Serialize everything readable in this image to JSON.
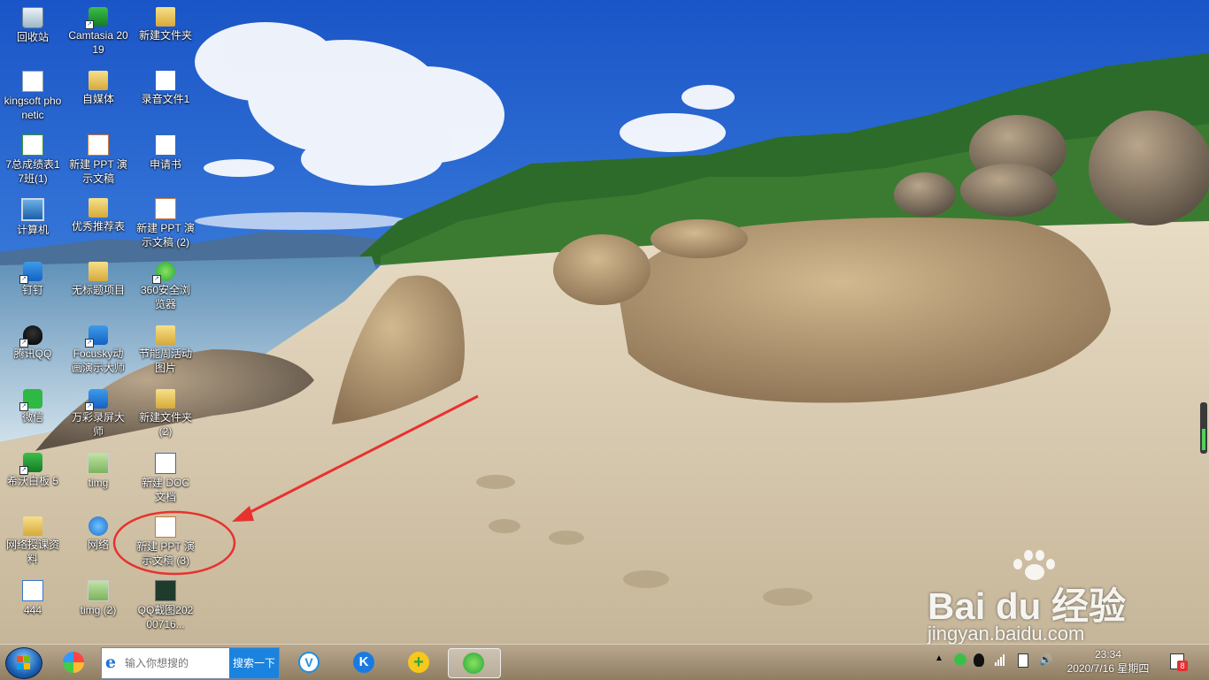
{
  "desktop_icons": [
    {
      "name": "recycle-bin",
      "label": "回收站",
      "glyph": "g-bin",
      "shortcut": false
    },
    {
      "name": "camtasia",
      "label": "Camtasia 2019",
      "glyph": "g-app-green",
      "shortcut": true
    },
    {
      "name": "new-folder",
      "label": "新建文件夹",
      "glyph": "g-folder",
      "shortcut": false
    },
    {
      "name": "kingsoft-phonetic",
      "label": "kingsoft phonetic",
      "glyph": "g-doc",
      "shortcut": false
    },
    {
      "name": "self-media",
      "label": "自媒体",
      "glyph": "g-folder",
      "shortcut": false
    },
    {
      "name": "recording-file-1",
      "label": "录音文件1",
      "glyph": "g-play",
      "shortcut": false
    },
    {
      "name": "grade-sheet",
      "label": "7总成绩表17班(1)",
      "glyph": "g-xls",
      "shortcut": false
    },
    {
      "name": "new-ppt",
      "label": "新建 PPT 演示文稿",
      "glyph": "g-ppt",
      "shortcut": false
    },
    {
      "name": "application-letter",
      "label": "申请书",
      "glyph": "g-word",
      "shortcut": false
    },
    {
      "name": "computer",
      "label": "计算机",
      "glyph": "g-pc",
      "shortcut": false
    },
    {
      "name": "excellent-recommendation",
      "label": "优秀推荐表",
      "glyph": "g-folder",
      "shortcut": false
    },
    {
      "name": "new-ppt-2",
      "label": "新建 PPT 演示文稿 (2)",
      "glyph": "g-ppt",
      "shortcut": false
    },
    {
      "name": "dingding",
      "label": "钉钉",
      "glyph": "g-blue",
      "shortcut": true
    },
    {
      "name": "untitled-project",
      "label": "无标题项目",
      "glyph": "g-folder",
      "shortcut": false
    },
    {
      "name": "360-browser",
      "label": "360安全浏览器",
      "glyph": "g-360",
      "shortcut": true
    },
    {
      "name": "tencent-qq",
      "label": "腾讯QQ",
      "glyph": "g-qq",
      "shortcut": true
    },
    {
      "name": "focusky",
      "label": "Focusky动画演示大师",
      "glyph": "g-blue",
      "shortcut": true
    },
    {
      "name": "energy-week-pictures",
      "label": "节能周活动图片",
      "glyph": "g-folder",
      "shortcut": false
    },
    {
      "name": "wechat",
      "label": "微信",
      "glyph": "g-wx",
      "shortcut": true
    },
    {
      "name": "wancai-recorder",
      "label": "万彩录屏大师",
      "glyph": "g-blue",
      "shortcut": true
    },
    {
      "name": "new-folder-2",
      "label": "新建文件夹 (2)",
      "glyph": "g-folder",
      "shortcut": false
    },
    {
      "name": "seewo-whiteboard",
      "label": "希沃白板 5",
      "glyph": "g-app-green",
      "shortcut": true
    },
    {
      "name": "timg",
      "label": "timg",
      "glyph": "g-img",
      "shortcut": false
    },
    {
      "name": "new-doc",
      "label": "新建 DOC 文档",
      "glyph": "g-word",
      "shortcut": false
    },
    {
      "name": "online-lesson-materials",
      "label": "网络授课资料",
      "glyph": "g-folder",
      "shortcut": false
    },
    {
      "name": "network",
      "label": "网络",
      "glyph": "g-net",
      "shortcut": false
    },
    {
      "name": "new-ppt-3",
      "label": "新建 PPT 演示文稿 (3)",
      "glyph": "g-ppt",
      "shortcut": false
    },
    {
      "name": "file-444",
      "label": "444",
      "glyph": "g-fs",
      "shortcut": false
    },
    {
      "name": "timg-2",
      "label": "timg (2)",
      "glyph": "g-img",
      "shortcut": false
    },
    {
      "name": "qq-screenshot",
      "label": "QQ截图20200716...",
      "glyph": "g-shot",
      "shortcut": false
    }
  ],
  "taskbar": {
    "search_placeholder": "输入你想搜的",
    "search_button": "搜索一下",
    "clock_time": "23:34",
    "clock_date": "2020/7/16 星期四",
    "notification_badge": "8"
  },
  "watermark": {
    "brand": "Bai du 经验",
    "url": "jingyan.baidu.com"
  }
}
